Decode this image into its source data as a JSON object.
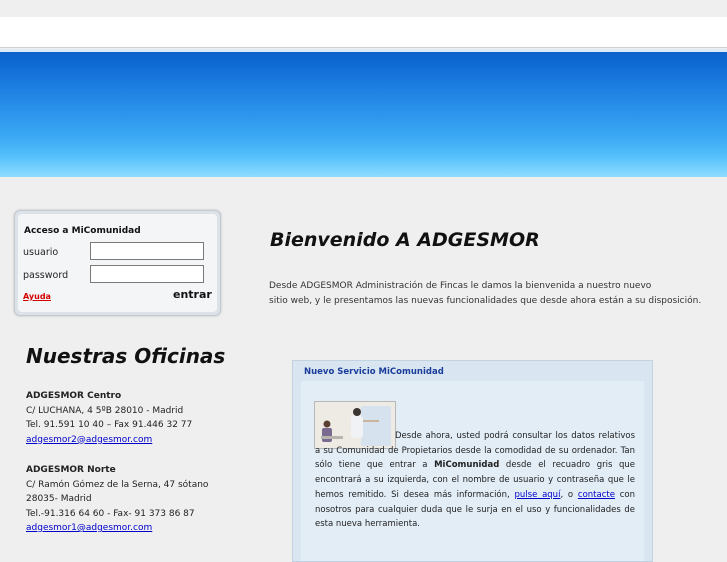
{
  "login": {
    "title": "Acceso a MiComunidad",
    "username_label": "usuario",
    "password_label": "password",
    "username_value": "",
    "password_value": "",
    "help_link": "Ayuda",
    "submit_label": "entrar"
  },
  "offices": {
    "title": "Nuestras Oficinas",
    "items": [
      {
        "name": "ADGESMOR Centro",
        "address": "C/ LUCHANA, 4 5ºB 28010 - Madrid",
        "phone": "Tel. 91.591 10 40 – Fax 91.446 32 77",
        "email": "adgesmor2@adgesmor.com"
      },
      {
        "name": "ADGESMOR Norte",
        "address": "C/ Ramón Gómez de la Serna, 47 sótano",
        "city": "28035- Madrid",
        "phone": "Tel.-91.316 64 60 - Fax- 91 373 86 87",
        "email": "adgesmor1@adgesmor.com"
      }
    ]
  },
  "welcome": {
    "title": "Bienvenido A ADGESMOR",
    "line1": "Desde ADGESMOR Administración de Fincas le damos la bienvenida a nuestro nuevo",
    "line2": "sitio web, y le presentamos las nuevas funcionalidades que desde ahora están a su disposición."
  },
  "news": {
    "title": "Nuevo Servicio MiComunidad",
    "text_a": "Desde ahora, usted podrá consultar los datos relativos a su Comunidad de Propietarios desde la comodidad de su ordenador. Tan sólo tiene que entrar a ",
    "text_bold": "MiComunidad",
    "text_b": " desde el recuadro gris que encontrará a su izquierda, con el nombre de usuario y contraseña que le hemos remitido. Si desea más información, ",
    "link_here": "pulse aquí",
    "text_c": ", o ",
    "link_contact": "contacte",
    "text_d": " con nosotros para cualquier duda que le surja en el uso y funcionalidades de esta nueva herramienta."
  }
}
